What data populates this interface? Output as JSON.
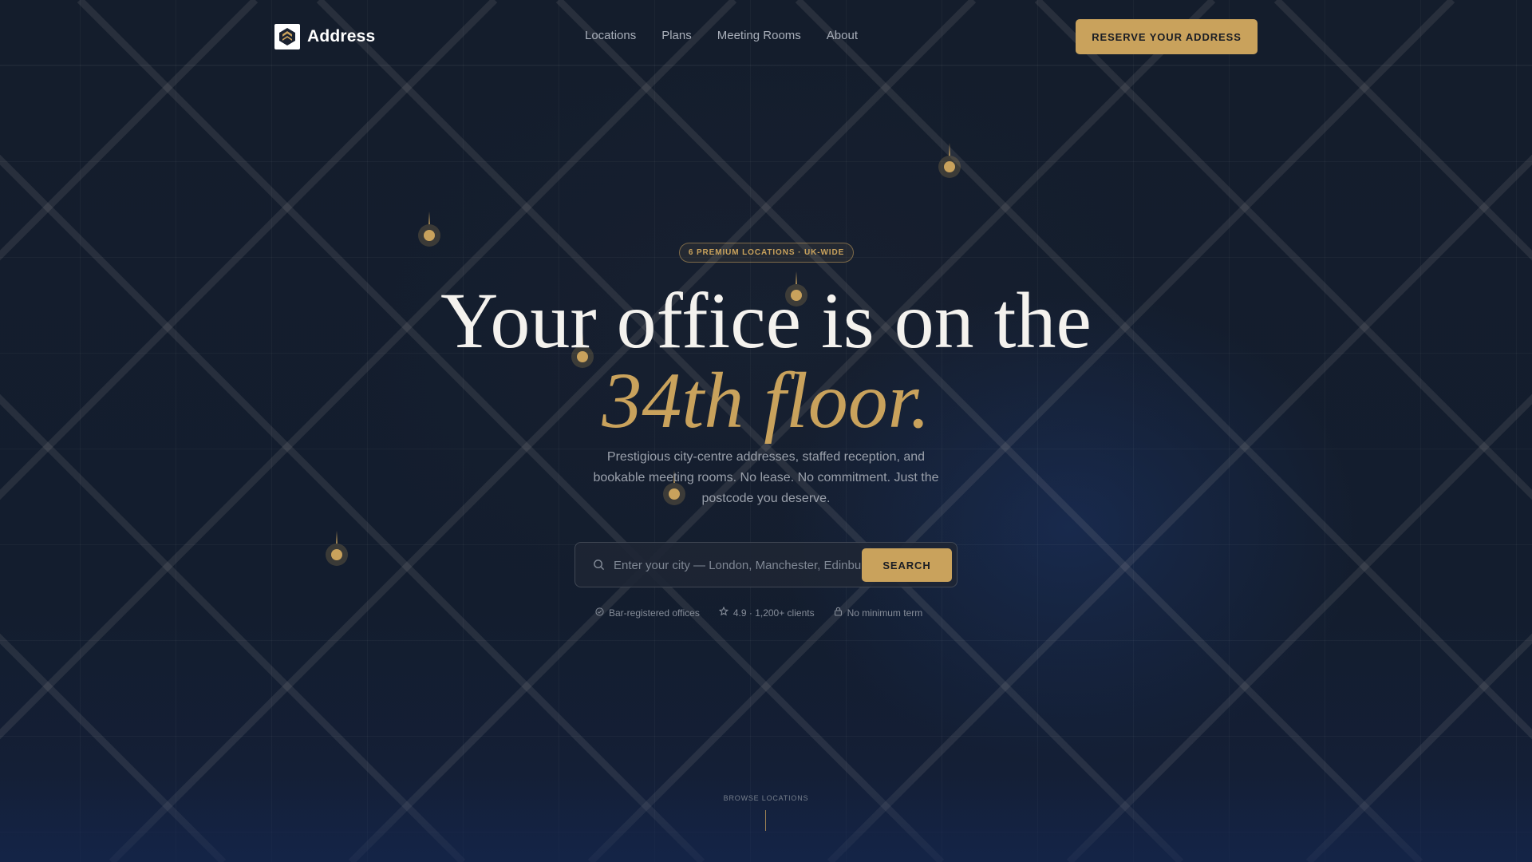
{
  "nav": {
    "brand_name": "Address",
    "links": [
      "Locations",
      "Plans",
      "Meeting Rooms",
      "About"
    ],
    "cta_label": "RESERVE YOUR ADDRESS"
  },
  "hero": {
    "badge": "6 PREMIUM LOCATIONS · UK-WIDE",
    "headline_line1": "Your office is on the",
    "headline_line2": "34th floor.",
    "subtext": "Prestigious city-centre addresses, staffed reception, and bookable meeting rooms. No lease. No commitment. Just the postcode you deserve."
  },
  "search": {
    "icon": "search-icon",
    "placeholder": "Enter your city — London, Manchester, Edinburgh",
    "value": "",
    "button_label": "SEARCH"
  },
  "trust": [
    {
      "icon": "check-circle-icon",
      "label": "Bar-registered offices"
    },
    {
      "icon": "star-icon",
      "label": "4.9 · 1,200+ clients"
    },
    {
      "icon": "lock-icon",
      "label": "No minimum term"
    }
  ],
  "browse": {
    "label": "BROWSE LOCATIONS"
  },
  "colors": {
    "background": "#131d2d",
    "accent_gold": "#c9a25c",
    "text_primary": "#f4f2ee",
    "text_muted": "#9aa0ab"
  },
  "map_pins": {
    "count": 7,
    "icon": "map-pin-icon"
  }
}
